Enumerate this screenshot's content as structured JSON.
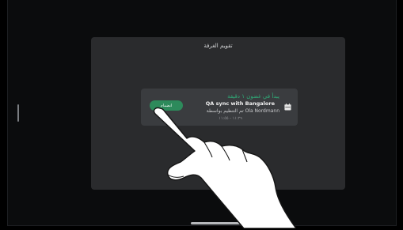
{
  "panel": {
    "title": "تقويم الغرفة"
  },
  "meeting": {
    "starts_in": "يبدأ في غضون ١ دقيقة",
    "title": "QA sync with Bangalore",
    "organizer": "تم التنظيم بواسطة Ola Nordmann",
    "time": "١١:٢٩ - ١١:٥٥",
    "join_label": "انضمام"
  },
  "icons": {
    "calendar": "calendar-icon",
    "hand": "pointing-hand-icon"
  },
  "colors": {
    "accent": "#2d8a5b",
    "starts_in_text": "#2fb07a",
    "panel": "#2a2b2d",
    "card": "#3a3c3f"
  }
}
